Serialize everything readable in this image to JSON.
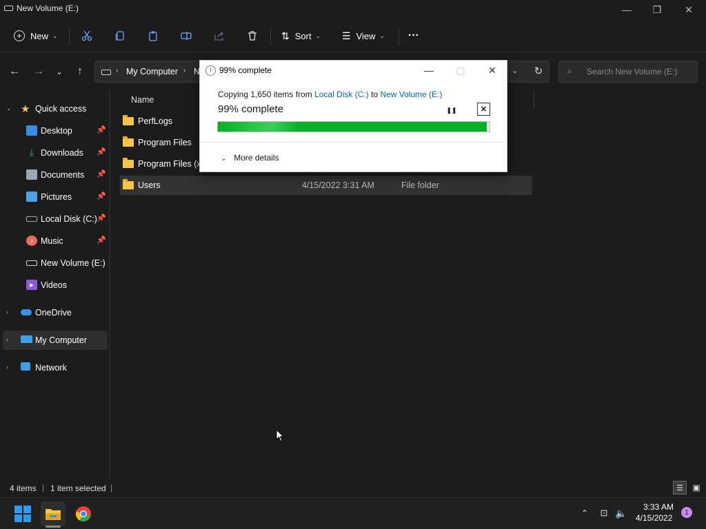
{
  "window": {
    "title": "New Volume (E:)",
    "minimize_glyph": "—",
    "maximize_glyph": "❐",
    "close_glyph": "✕"
  },
  "toolbar": {
    "new_label": "New",
    "sort_label": "Sort",
    "view_label": "View",
    "more_glyph": "···"
  },
  "address": {
    "crumbs": [
      "My Computer",
      "N"
    ],
    "search_placeholder": "Search New Volume (E:)"
  },
  "nav": {
    "quick_access": "Quick access",
    "items": [
      {
        "label": "Desktop",
        "icon": "desktop-icon",
        "color": "#3a8ee6",
        "pinned": true
      },
      {
        "label": "Downloads",
        "icon": "download-icon",
        "color": "#38b26b",
        "pinned": true
      },
      {
        "label": "Documents",
        "icon": "document-icon",
        "color": "#9aa7b8",
        "pinned": true
      },
      {
        "label": "Pictures",
        "icon": "pictures-icon",
        "color": "#4aa3e8",
        "pinned": true
      },
      {
        "label": "Local Disk (C:)",
        "icon": "drive-icon",
        "color": "#9aa7b8",
        "pinned": true
      },
      {
        "label": "Music",
        "icon": "music-icon",
        "color": "#e86a5a",
        "pinned": true
      },
      {
        "label": "New Volume (E:)",
        "icon": "drive-icon",
        "color": "#cfcfcf",
        "pinned": false
      },
      {
        "label": "Videos",
        "icon": "videos-icon",
        "color": "#8a5ad8",
        "pinned": false
      }
    ],
    "onedrive": "OneDrive",
    "my_computer": "My Computer",
    "network": "Network",
    "pin_glyph": "📌"
  },
  "content": {
    "column_name": "Name",
    "rows": [
      {
        "name": "PerfLogs",
        "date": "",
        "type": ""
      },
      {
        "name": "Program Files",
        "date": "",
        "type": ""
      },
      {
        "name": "Program Files (x8",
        "date": "",
        "type": ""
      },
      {
        "name": "Users",
        "date": "4/15/2022 3:31 AM",
        "type": "File folder"
      }
    ]
  },
  "status": {
    "items_count": "4 items",
    "selected": "1 item selected"
  },
  "dialog": {
    "title": "99% complete",
    "copying_prefix": "Copying 1,650 items from ",
    "source": "Local Disk (C:)",
    "to_word": " to ",
    "destination": "New Volume (E:)",
    "percent_label": "99% complete",
    "progress": 0.99,
    "more_details": "More details",
    "pause_glyph": "❚❚",
    "cancel_glyph": "✕",
    "minimize_glyph": "—",
    "close_glyph": "✕"
  },
  "taskbar": {
    "time": "3:33 AM",
    "date": "4/15/2022",
    "notification_count": "1"
  },
  "colors": {
    "accent": "#0066b4",
    "progress_green": "#06b025",
    "folder_yellow": "#f8c646"
  }
}
